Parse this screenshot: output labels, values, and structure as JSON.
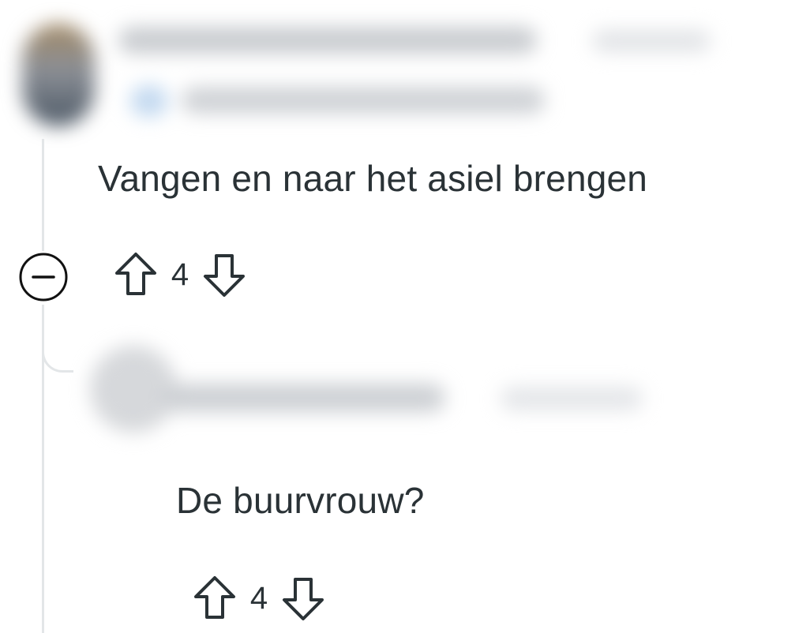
{
  "comment": {
    "text": "Vangen en naar het asiel brengen",
    "score": "4",
    "upvote_icon": "arrow-up-outline-icon",
    "downvote_icon": "arrow-down-outline-icon",
    "collapse_icon": "collapse-minus-circle-icon"
  },
  "reply": {
    "text": "De buurvrouw?",
    "score": "4",
    "upvote_icon": "arrow-up-outline-icon",
    "downvote_icon": "arrow-down-outline-icon"
  },
  "colors": {
    "text": "#2a3236",
    "thread_line": "#e3e6e8"
  }
}
